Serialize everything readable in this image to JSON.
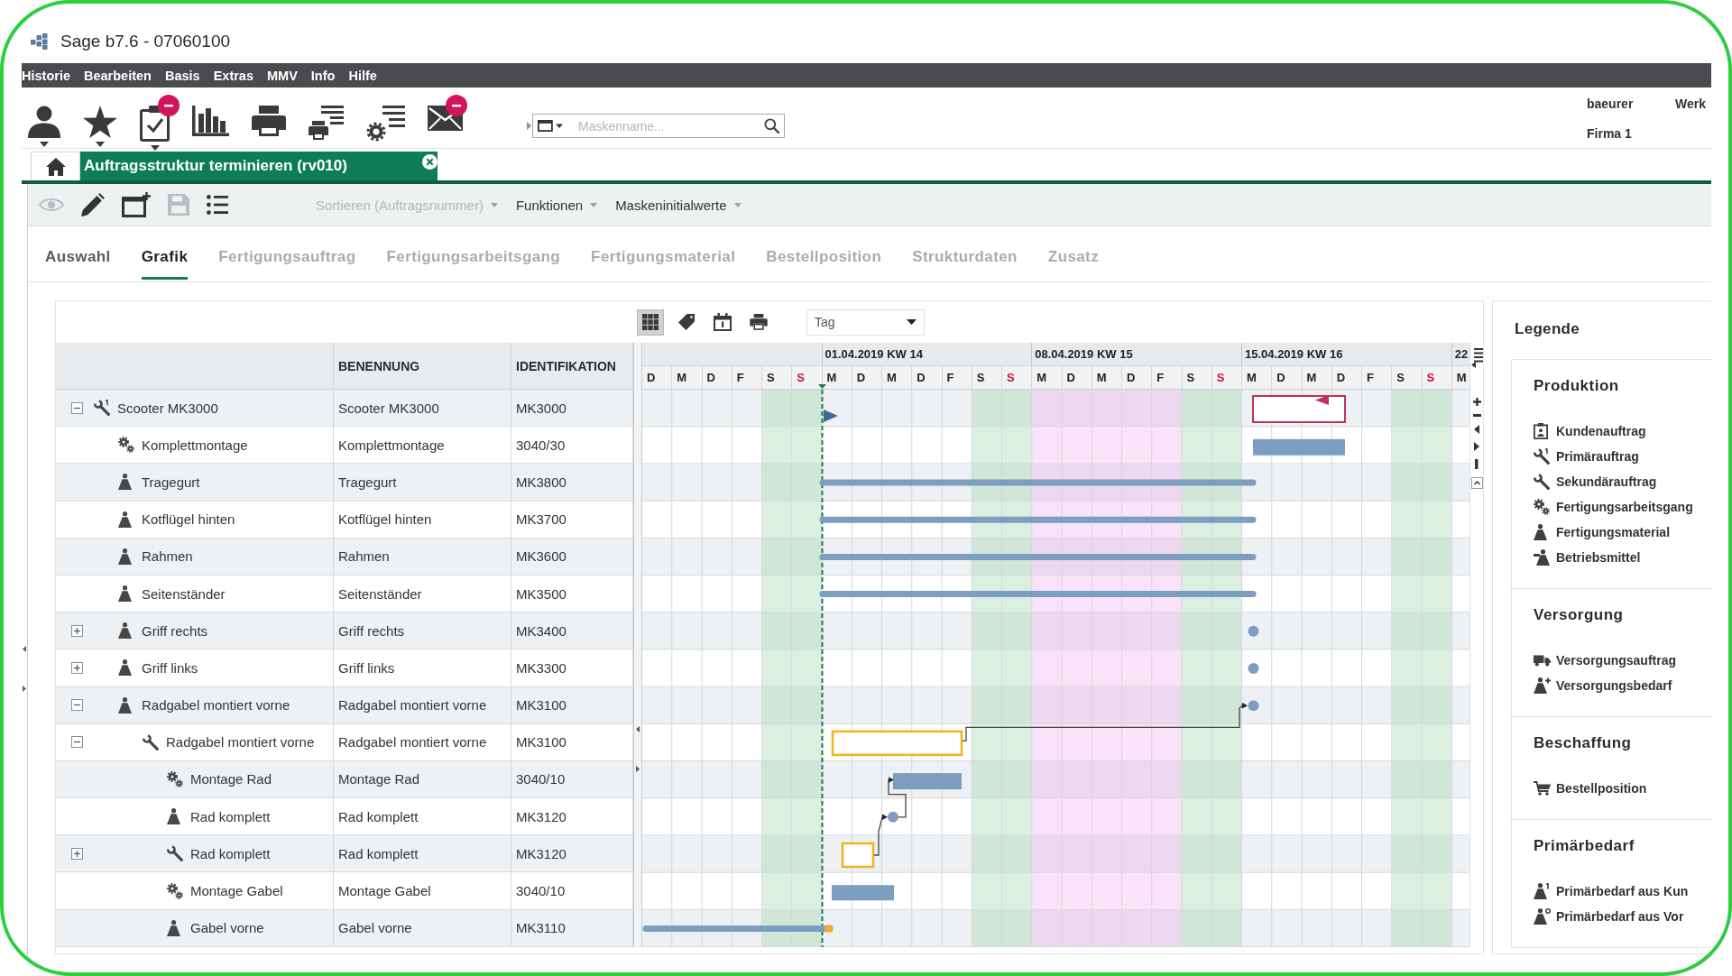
{
  "window": {
    "title": "Sage b7.6 - 07060100"
  },
  "menu": [
    {
      "label": "Historie"
    },
    {
      "label": "Bearbeiten"
    },
    {
      "label": "Basis"
    },
    {
      "label": "Extras"
    },
    {
      "label": "MMV"
    },
    {
      "label": "Info"
    },
    {
      "label": "Hilfe"
    }
  ],
  "toolbar": {
    "buttons": [
      {
        "kind": "user",
        "dropdown": true,
        "notification": false
      },
      {
        "kind": "star",
        "dropdown": true,
        "notification": false
      },
      {
        "kind": "clipboard",
        "dropdown": true,
        "notification": true
      },
      {
        "kind": "chart",
        "dropdown": false,
        "notification": false
      },
      {
        "kind": "printer",
        "dropdown": false,
        "notification": false
      },
      {
        "kind": "printlist",
        "dropdown": false,
        "notification": false
      },
      {
        "kind": "gearlist",
        "dropdown": false,
        "notification": false
      },
      {
        "kind": "mail",
        "dropdown": false,
        "notification": true
      }
    ],
    "search": {
      "placeholder": "Maskenname..."
    },
    "user_info": {
      "user": "baeurer",
      "plant_label": "Werk",
      "company": "Firma 1"
    }
  },
  "document_tabs": [
    {
      "label": "Auftragsstruktur terminieren (rv010)",
      "selected": true,
      "closable": true
    }
  ],
  "actions": {
    "buttons": [
      {
        "kind": "view",
        "disabled": true
      },
      {
        "kind": "edit",
        "disabled": false
      },
      {
        "kind": "newwindow",
        "disabled": false
      },
      {
        "kind": "save",
        "disabled": true
      },
      {
        "kind": "list",
        "disabled": false
      }
    ],
    "menus": [
      {
        "label": "Sortieren (Auftragsnummer)",
        "disabled": true
      },
      {
        "label": "Funktionen",
        "disabled": false
      },
      {
        "label": "Maskeninitialwerte",
        "disabled": false
      }
    ]
  },
  "tabs": [
    {
      "label": "Auswahl",
      "selected": false,
      "disabled": false
    },
    {
      "label": "Grafik",
      "selected": true,
      "disabled": false
    },
    {
      "label": "Fertigungsauftrag",
      "selected": false,
      "disabled": true
    },
    {
      "label": "Fertigungsarbeitsgang",
      "selected": false,
      "disabled": true
    },
    {
      "label": "Fertigungsmaterial",
      "selected": false,
      "disabled": true
    },
    {
      "label": "Bestellposition",
      "selected": false,
      "disabled": true
    },
    {
      "label": "Strukturdaten",
      "selected": false,
      "disabled": true
    },
    {
      "label": "Zusatz",
      "selected": false,
      "disabled": true
    }
  ],
  "gantt": {
    "toolbar": [
      {
        "kind": "grid",
        "selected": true
      },
      {
        "kind": "tag",
        "selected": false
      },
      {
        "kind": "calendar",
        "selected": false
      },
      {
        "kind": "print",
        "selected": false
      }
    ],
    "scale": {
      "value": "Tag"
    },
    "weeks": [
      {
        "days": [
          {
            "letter": "D",
            "kind": "workday",
            "today": false
          },
          {
            "letter": "M",
            "kind": "workday",
            "today": false
          },
          {
            "letter": "D",
            "kind": "workday",
            "today": false
          },
          {
            "letter": "F",
            "kind": "workday",
            "today": false
          },
          {
            "letter": "S",
            "kind": "saturday",
            "today": false
          },
          {
            "letter": "S",
            "kind": "sunday",
            "today": false
          }
        ]
      },
      {
        "label": "01.04.2019 KW 14",
        "days": [
          {
            "letter": "M",
            "kind": "workday",
            "today": true
          },
          {
            "letter": "D",
            "kind": "workday",
            "today": false
          },
          {
            "letter": "M",
            "kind": "workday",
            "today": false
          },
          {
            "letter": "D",
            "kind": "workday",
            "today": false
          },
          {
            "letter": "F",
            "kind": "workday",
            "today": false
          },
          {
            "letter": "S",
            "kind": "saturday",
            "today": false
          },
          {
            "letter": "S",
            "kind": "sunday",
            "today": false
          }
        ]
      },
      {
        "label": "08.04.2019 KW 15",
        "days": [
          {
            "letter": "M",
            "kind": "highlighted",
            "today": false
          },
          {
            "letter": "D",
            "kind": "highlighted",
            "today": false
          },
          {
            "letter": "M",
            "kind": "highlighted",
            "today": false
          },
          {
            "letter": "D",
            "kind": "highlighted",
            "today": false
          },
          {
            "letter": "F",
            "kind": "highlighted",
            "today": false
          },
          {
            "letter": "S",
            "kind": "saturday",
            "today": false
          },
          {
            "letter": "S",
            "kind": "sunday",
            "today": false
          }
        ]
      },
      {
        "label": "15.04.2019 KW 16",
        "days": [
          {
            "letter": "M",
            "kind": "workday",
            "today": false
          },
          {
            "letter": "D",
            "kind": "workday",
            "today": false
          },
          {
            "letter": "M",
            "kind": "workday",
            "today": false
          },
          {
            "letter": "D",
            "kind": "workday",
            "today": false
          },
          {
            "letter": "F",
            "kind": "workday",
            "today": false
          },
          {
            "letter": "S",
            "kind": "saturday",
            "today": false
          },
          {
            "letter": "S",
            "kind": "sunday",
            "today": false
          }
        ]
      },
      {
        "label": "22",
        "days": [
          {
            "letter": "M",
            "kind": "workday",
            "today": false
          }
        ]
      }
    ]
  },
  "table": {
    "columns": [
      "BENENNUNG",
      "IDENTIFIKATION"
    ],
    "rows": [
      {
        "label": "Scooter MK3000",
        "kind": "primary",
        "expanded": true,
        "cells": [
          "Scooter MK3000",
          "MK3000"
        ],
        "children": [
          {
            "label": "Komplettmontage",
            "kind": "operation",
            "cells": [
              "Komplettmontage",
              "3040/30"
            ]
          },
          {
            "label": "Tragegurt",
            "kind": "material",
            "cells": [
              "Tragegurt",
              "MK3800"
            ]
          },
          {
            "label": "Kotflügel hinten",
            "kind": "material",
            "cells": [
              "Kotflügel hinten",
              "MK3700"
            ]
          },
          {
            "label": "Rahmen",
            "kind": "material",
            "cells": [
              "Rahmen",
              "MK3600"
            ]
          },
          {
            "label": "Seitenständer",
            "kind": "material",
            "cells": [
              "Seitenständer",
              "MK3500"
            ]
          },
          {
            "label": "Griff rechts",
            "kind": "material",
            "expanded": false,
            "cells": [
              "Griff rechts",
              "MK3400"
            ]
          },
          {
            "label": "Griff links",
            "kind": "material",
            "expanded": false,
            "cells": [
              "Griff links",
              "MK3300"
            ]
          },
          {
            "label": "Radgabel montiert vorne",
            "kind": "material",
            "expanded": true,
            "cells": [
              "Radgabel montiert vorne",
              "MK3100"
            ],
            "children": [
              {
                "label": "Radgabel montiert vorne",
                "kind": "secondary",
                "expanded": true,
                "cells": [
                  "Radgabel montiert vorne",
                  "MK3100"
                ],
                "children": [
                  {
                    "label": "Montage Rad",
                    "kind": "operation",
                    "cells": [
                      "Montage Rad",
                      "3040/10"
                    ]
                  },
                  {
                    "label": "Rad komplett",
                    "kind": "material",
                    "cells": [
                      "Rad komplett",
                      "MK3120"
                    ]
                  },
                  {
                    "label": "Rad komplett",
                    "kind": "secondary",
                    "expanded": false,
                    "cells": [
                      "Rad komplett",
                      "MK3120"
                    ]
                  },
                  {
                    "label": "Montage Gabel",
                    "kind": "operation",
                    "cells": [
                      "Montage Gabel",
                      "3040/10"
                    ]
                  },
                  {
                    "label": "Gabel vorne",
                    "kind": "material",
                    "cells": [
                      "Gabel vorne",
                      "MK3110"
                    ]
                  }
                ]
              }
            ]
          }
        ]
      }
    ]
  },
  "legend": {
    "title": "Legende",
    "sections": [
      {
        "title": "Produktion",
        "items": [
          {
            "label": "Kundenauftrag",
            "kind": "customer"
          },
          {
            "label": "Primärauftrag",
            "kind": "primary"
          },
          {
            "label": "Sekundärauftrag",
            "kind": "secondary"
          },
          {
            "label": "Fertigungsarbeitsgang",
            "kind": "operation"
          },
          {
            "label": "Fertigungsmaterial",
            "kind": "material"
          },
          {
            "label": "Betriebsmittel",
            "kind": "resource"
          }
        ]
      },
      {
        "title": "Versorgung",
        "items": [
          {
            "label": "Versorgungsauftrag",
            "kind": "supply"
          },
          {
            "label": "Versorgungsbedarf",
            "kind": "demand"
          }
        ]
      },
      {
        "title": "Beschaffung",
        "items": [
          {
            "label": "Bestellposition",
            "kind": "purchase"
          }
        ]
      },
      {
        "title": "Primärbedarf",
        "items": [
          {
            "label": "Primärbedarf aus Kun",
            "kind": "primarycustomer"
          },
          {
            "label": "Primärbedarf aus Vor",
            "kind": "primarystock"
          }
        ]
      }
    ]
  }
}
